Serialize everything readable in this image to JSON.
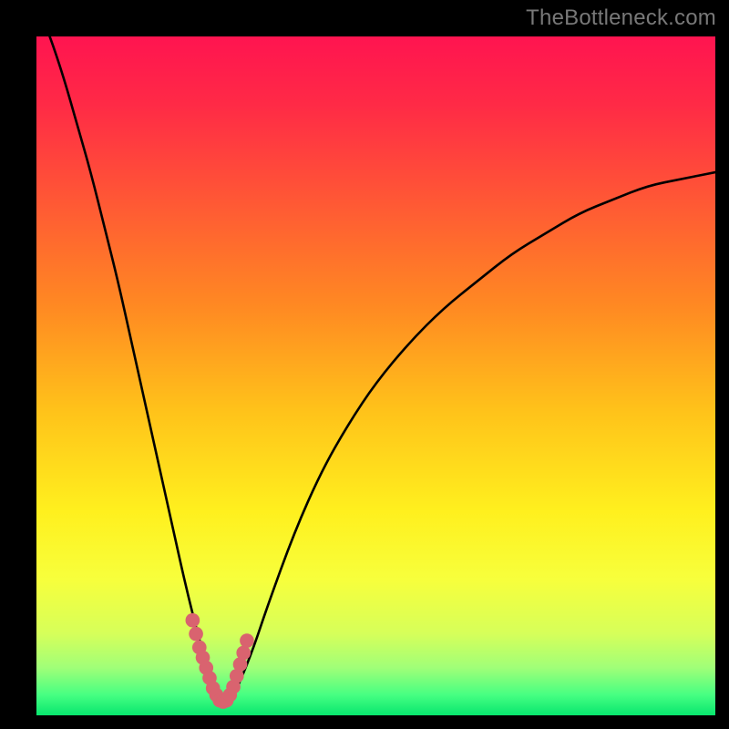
{
  "watermark": "TheBottleneck.com",
  "colors": {
    "frame": "#000000",
    "curve_stroke": "#000000",
    "highlight_stroke": "#d9636f",
    "gradient_stops": [
      {
        "offset": 0.0,
        "color": "#ff1450"
      },
      {
        "offset": 0.1,
        "color": "#ff2a46"
      },
      {
        "offset": 0.25,
        "color": "#ff5a34"
      },
      {
        "offset": 0.4,
        "color": "#ff8a22"
      },
      {
        "offset": 0.55,
        "color": "#ffc21a"
      },
      {
        "offset": 0.7,
        "color": "#fff01e"
      },
      {
        "offset": 0.8,
        "color": "#f7ff3c"
      },
      {
        "offset": 0.88,
        "color": "#d6ff5a"
      },
      {
        "offset": 0.93,
        "color": "#a0ff78"
      },
      {
        "offset": 0.97,
        "color": "#46ff82"
      },
      {
        "offset": 1.0,
        "color": "#08e66e"
      }
    ]
  },
  "chart_data": {
    "type": "line",
    "title": "",
    "xlabel": "",
    "ylabel": "",
    "xlim": [
      0,
      100
    ],
    "ylim": [
      0,
      100
    ],
    "grid": false,
    "series": [
      {
        "name": "bottleneck-curve",
        "x": [
          0,
          2,
          4,
          6,
          8,
          10,
          12,
          14,
          16,
          18,
          20,
          22,
          24,
          25,
          26,
          27,
          28,
          29,
          30,
          32,
          34,
          38,
          42,
          46,
          50,
          55,
          60,
          65,
          70,
          75,
          80,
          85,
          90,
          95,
          100
        ],
        "y": [
          105,
          100,
          94,
          87,
          80,
          72,
          64,
          55,
          46,
          37,
          28,
          19,
          11,
          8,
          5,
          3,
          2,
          3,
          5,
          10,
          16,
          27,
          36,
          43,
          49,
          55,
          60,
          64,
          68,
          71,
          74,
          76,
          78,
          79,
          80
        ]
      },
      {
        "name": "bottleneck-highlight",
        "x": [
          23.0,
          23.5,
          24.0,
          24.5,
          25.0,
          25.5,
          26.0,
          26.5,
          27.0,
          27.5,
          28.0,
          28.5,
          29.0,
          29.5,
          30.0,
          30.5,
          31.0
        ],
        "y": [
          14.0,
          12.0,
          10.0,
          8.5,
          7.0,
          5.5,
          4.0,
          3.0,
          2.2,
          2.0,
          2.2,
          3.0,
          4.2,
          5.8,
          7.5,
          9.2,
          11.0
        ]
      }
    ],
    "annotations": []
  }
}
